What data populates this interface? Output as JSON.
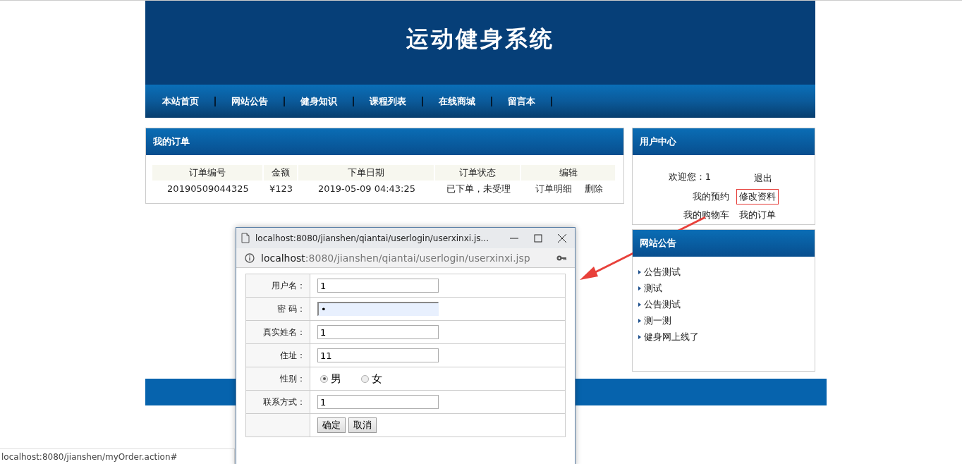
{
  "site": {
    "title": "运动健身系统"
  },
  "nav": [
    {
      "label": "本站首页"
    },
    {
      "label": "网站公告"
    },
    {
      "label": "健身知识"
    },
    {
      "label": "课程列表"
    },
    {
      "label": "在线商城"
    },
    {
      "label": "留言本"
    }
  ],
  "orders": {
    "title": "我的订单",
    "columns": [
      "订单编号",
      "金额",
      "下单日期",
      "订单状态",
      "编辑"
    ],
    "rows": [
      {
        "number": "20190509044325",
        "amount": "¥123",
        "date": "2019-05-09 04:43:25",
        "status": "已下单，未受理",
        "actions": [
          "订单明细",
          "删除"
        ]
      }
    ]
  },
  "user_center": {
    "title": "用户中心",
    "welcome": "欢迎您：1",
    "links": [
      {
        "label": "退出",
        "highlighted": false
      },
      {
        "label": "我的预约",
        "highlighted": false
      },
      {
        "label": "修改资料",
        "highlighted": true
      },
      {
        "label": "我的购物车",
        "highlighted": false
      },
      {
        "label": "我的订单",
        "highlighted": false
      }
    ]
  },
  "notices": {
    "title": "网站公告",
    "items": [
      "公告测试",
      "测试",
      "公告测试",
      "测一测",
      "健身网上线了"
    ]
  },
  "popup": {
    "title": "localhost:8080/jianshen/qiantai/userlogin/userxinxi.js...",
    "address_host": "localhost",
    "address_rest": ":8080/jianshen/qiantai/userlogin/userxinxi.jsp",
    "fields": [
      {
        "kind": "text",
        "label": "用户名：",
        "value": "1",
        "focused": false
      },
      {
        "kind": "text",
        "label": "密 码：",
        "value": "•",
        "focused": true
      },
      {
        "kind": "text",
        "label": "真实姓名：",
        "value": "1",
        "focused": false
      },
      {
        "kind": "text",
        "label": "住址：",
        "value": "11",
        "focused": false
      },
      {
        "kind": "radio",
        "label": "性别：",
        "options": [
          {
            "label": "男",
            "selected": true
          },
          {
            "label": "女",
            "selected": false
          }
        ]
      },
      {
        "kind": "text",
        "label": "联系方式：",
        "value": "1",
        "focused": false
      }
    ],
    "buttons": [
      "确定",
      "取消"
    ]
  },
  "status_bar": "localhost:8080/jianshen/myOrder.action#"
}
